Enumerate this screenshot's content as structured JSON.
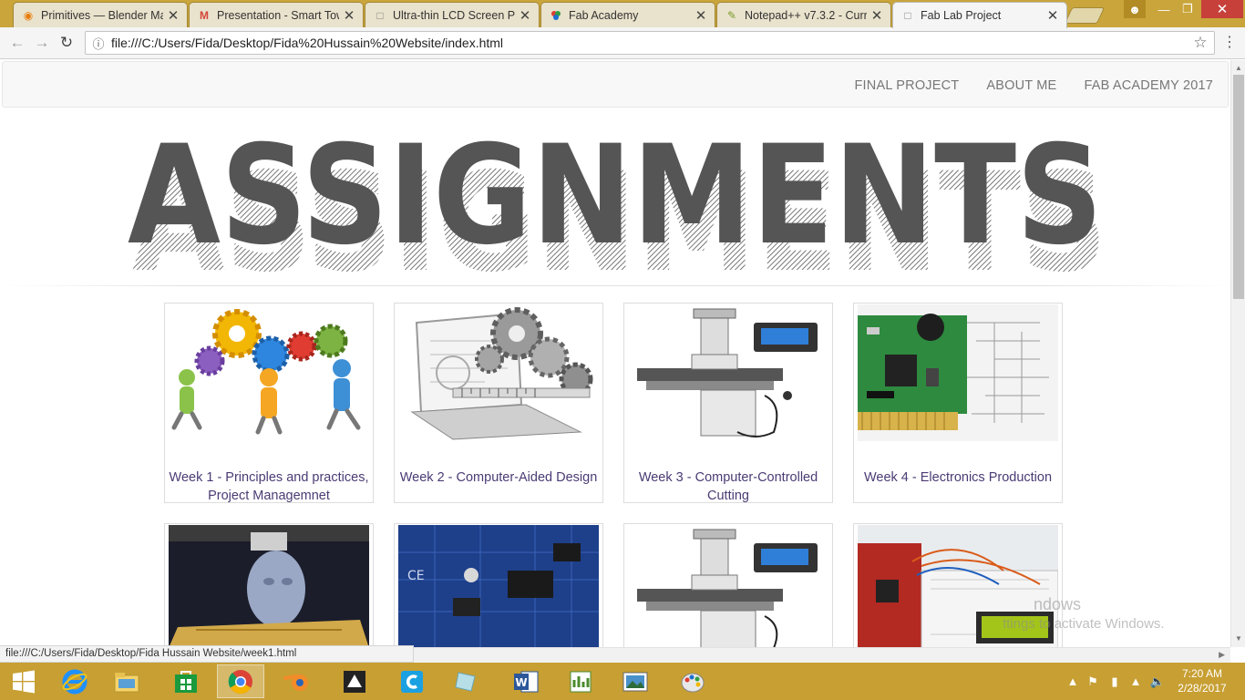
{
  "browser": {
    "tabs": [
      {
        "title": "Primitives — Blender Ma",
        "icon": "blender-icon",
        "active": false
      },
      {
        "title": "Presentation - Smart Tow",
        "icon": "gmail-icon",
        "active": false
      },
      {
        "title": "Ultra-thin LCD Screen Pr",
        "icon": "page-icon",
        "active": false
      },
      {
        "title": "Fab Academy",
        "icon": "fab-academy-icon",
        "active": false
      },
      {
        "title": "Notepad++ v7.3.2 - Curr",
        "icon": "notepad-icon",
        "active": false
      },
      {
        "title": "Fab Lab Project",
        "icon": "page-icon",
        "active": true
      }
    ],
    "url": "file:///C:/Users/Fida/Desktop/Fida%20Hussain%20Website/index.html",
    "status_url": "file:///C:/Users/Fida/Desktop/Fida Hussain Website/week1.html"
  },
  "nav": {
    "links": [
      "FINAL PROJECT",
      "ABOUT ME",
      "FAB ACADEMY 2017"
    ]
  },
  "hero": {
    "title": "ASSIGNMENTS",
    "color": "#555555"
  },
  "cards": [
    {
      "caption": "Week 1 - Principles and practices, Project Managemnet",
      "image": "gears-team-people"
    },
    {
      "caption": "Week 2 - Computer-Aided Design",
      "image": "laptop-gears-caliper"
    },
    {
      "caption": "Week 3 - Computer-Controlled Cutting",
      "image": "milling-machine"
    },
    {
      "caption": "Week 4 - Electronics Production",
      "image": "circuit-board-schematic"
    },
    {
      "caption": "",
      "image": "3d-printer-head"
    },
    {
      "caption": "",
      "image": "blue-pcb-closeup"
    },
    {
      "caption": "",
      "image": "milling-machine"
    },
    {
      "caption": "",
      "image": "breadboard-lcd"
    }
  ],
  "watermark": {
    "title": "ndows",
    "text": "ttings to activate Windows."
  },
  "taskbar": {
    "apps": [
      "windows-start-icon",
      "internet-explorer-icon",
      "file-explorer-icon",
      "store-icon",
      "chrome-icon",
      "blender-icon",
      "inkscape-icon",
      "c-app-icon",
      "glass-icon",
      "word-icon",
      "project-icon",
      "photos-icon",
      "paint-icon"
    ],
    "time": "7:20 AM",
    "date": "2/28/2017"
  },
  "colors": {
    "taskbar": "#c79f33",
    "link": "#4b3b74",
    "nav_text": "#777777"
  }
}
